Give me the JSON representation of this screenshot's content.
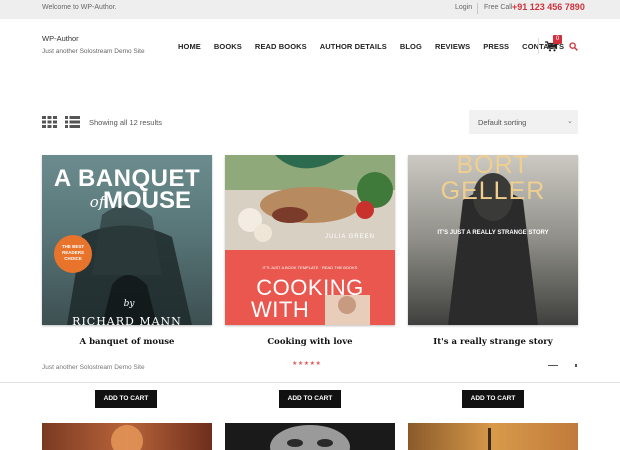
{
  "topbar": {
    "welcome": "Welcome to WP-Author.",
    "login": "Login",
    "call_label": "Free Call",
    "phone": "+91 123 456 7890"
  },
  "header": {
    "site_title": "WP-Author",
    "site_description": "Just another Solostream Demo Site",
    "nav": [
      "HOME",
      "BOOKS",
      "READ BOOKS",
      "AUTHOR DETAILS",
      "BLOG",
      "REVIEWS",
      "PRESS",
      "CONTACTS"
    ],
    "cart_count": "0"
  },
  "shop": {
    "result_count": "Showing all 12 results",
    "sorting_selected": "Default sorting",
    "background_description": "Just another Solostream Demo Site",
    "products": [
      {
        "title": "A banquet of mouse",
        "cover_line1": "A BANQUET",
        "cover_line2": "of",
        "cover_line3": "MOUSE",
        "badge": [
          "THE BEST",
          "READERS",
          "CHOICE"
        ],
        "by": "by",
        "author": "RICHARD MANN",
        "add_to_cart": "ADD TO CART"
      },
      {
        "title": "Cooking with love",
        "cover_author": "JULIA GREEN",
        "cover_tagline": "IT'S JUST A BOOK TEMPLATE · READ THE BOOKS",
        "cover_big1": "COOKING",
        "cover_big2": "WITH",
        "stars": "★★★★★",
        "add_to_cart": "ADD TO CART"
      },
      {
        "title": "It's a really strange story",
        "cover_name1": "BORT",
        "cover_name2": "GELLER",
        "cover_subtitle": "IT'S JUST A REALLY STRANGE STORY",
        "add_to_cart": "ADD TO CART"
      }
    ]
  },
  "colors": {
    "accent": "#d0323d",
    "button_bg": "#111111",
    "topbar_bg": "#eeeeee"
  }
}
